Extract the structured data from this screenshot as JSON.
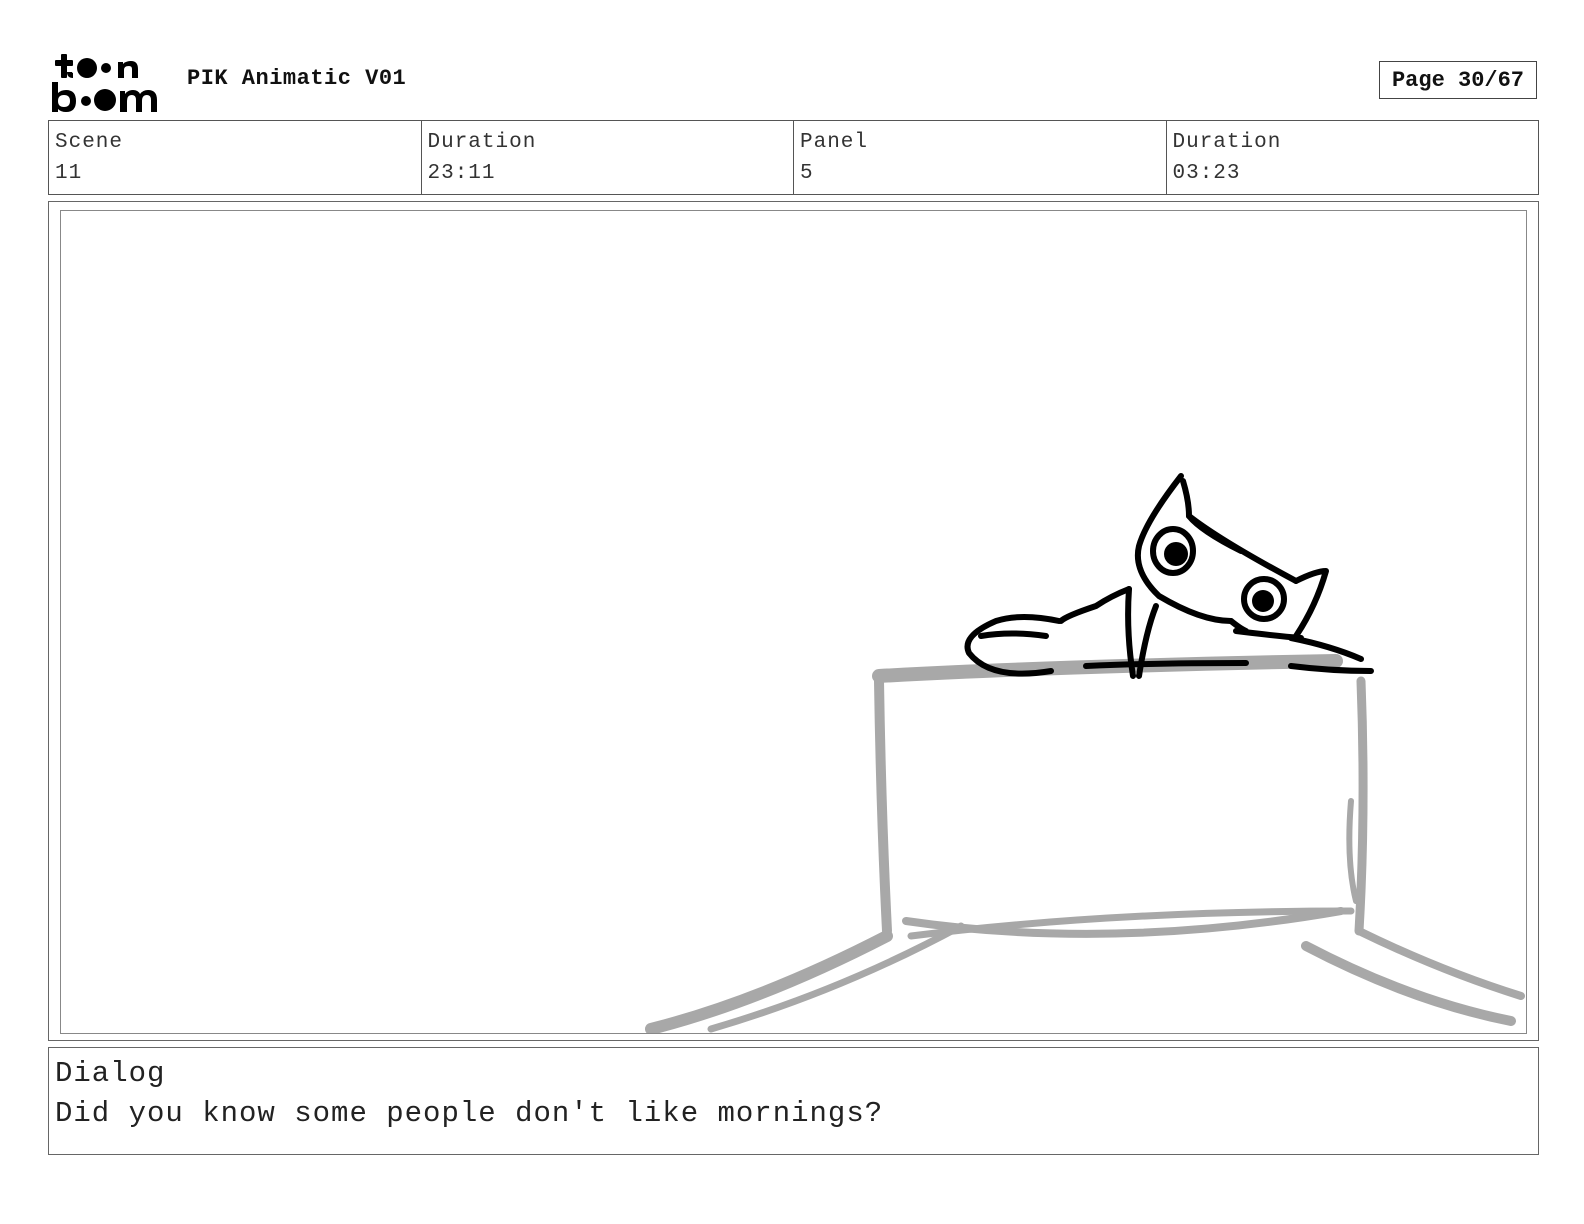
{
  "header": {
    "logo_text_top": "toon",
    "logo_text_bottom": "boom",
    "project_title": "PIK Animatic V01",
    "page_indicator": "Page 30/67"
  },
  "info": {
    "scene_label": "Scene",
    "scene_value": "11",
    "scene_duration_label": "Duration",
    "scene_duration_value": "23:11",
    "panel_label": "Panel",
    "panel_value": "5",
    "panel_duration_label": "Duration",
    "panel_duration_value": "03:23"
  },
  "dialog": {
    "label": "Dialog",
    "text": "Did you know some people don't like mornings?"
  },
  "colors": {
    "sketch_ink": "#000000",
    "layout_gray": "#a8a8a8"
  }
}
